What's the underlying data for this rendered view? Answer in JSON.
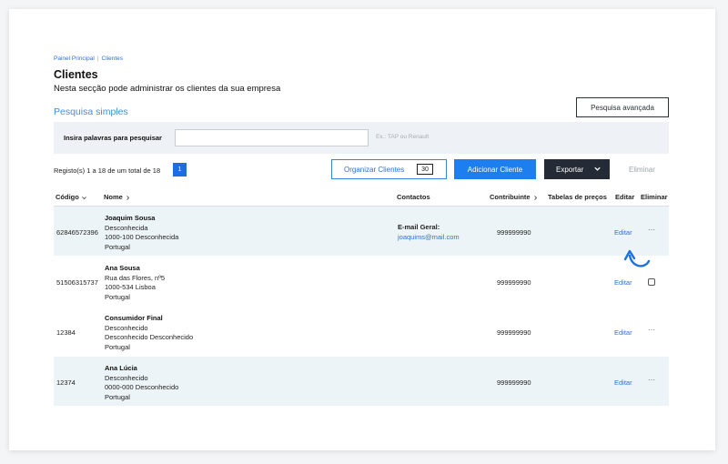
{
  "breadcrumb": {
    "home": "Painel Principal",
    "current": "Clientes"
  },
  "page": {
    "title": "Clientes",
    "subtitle": "Nesta secção pode administrar os clientes da sua empresa"
  },
  "search": {
    "section_title": "Pesquisa simples",
    "advanced_label": "Pesquisa avançada",
    "field_label": "Insira palavras para pesquisar",
    "value": "",
    "hint": "Ex.: TAP ou Renault"
  },
  "toolbar": {
    "records_text": "Registo(s) 1 a 18 de um total de 18",
    "page_number": "1",
    "organize_label": "Organizar Clientes",
    "organize_count": "30",
    "add_label": "Adicionar Cliente",
    "export_label": "Exportar",
    "delete_label": "Eliminar"
  },
  "table": {
    "columns": {
      "code": "Código",
      "name": "Nome",
      "contacts": "Contactos",
      "taxpayer": "Contribuinte",
      "price_tables": "Tabelas de preços",
      "edit": "Editar",
      "delete": "Eliminar"
    },
    "rows": [
      {
        "code": "62846572396",
        "name": "Joaquim Sousa",
        "line1": "Desconhecida",
        "line2": "1000-100 Desconhecida",
        "line3": "Portugal",
        "contact_label": "E-mail Geral:",
        "contact_value": "joaquims@mail.com",
        "taxpayer": "999999990",
        "edit": "Editar",
        "action": "···"
      },
      {
        "code": "51506315737",
        "name": "Ana Sousa",
        "line1": "Rua das Flores, nº5",
        "line2": "1000-534 Lisboa",
        "line3": "Portugal",
        "taxpayer": "999999990",
        "edit": "Editar",
        "action": "checkbox"
      },
      {
        "code": "12384",
        "name": "Consumidor Final",
        "line1": "Desconhecido",
        "line2": "Desconhecido Desconhecido",
        "line3": "Portugal",
        "taxpayer": "999999990",
        "edit": "Editar",
        "action": "···"
      },
      {
        "code": "12374",
        "name": "Ana Lúcia",
        "line1": "Desconhecido",
        "line2": "0000-000 Desconhecido",
        "line3": "Portugal",
        "taxpayer": "999999990",
        "edit": "Editar",
        "action": "···"
      }
    ]
  },
  "colors": {
    "accent": "#1d7ef0",
    "dark_button": "#242b36",
    "link": "#2f6fdb",
    "row_highlight": "#edf4f7"
  },
  "icons": [
    "chevron-down-icon",
    "chevron-right-icon",
    "curved-arrow-icon",
    "more-icon",
    "checkbox-icon"
  ]
}
